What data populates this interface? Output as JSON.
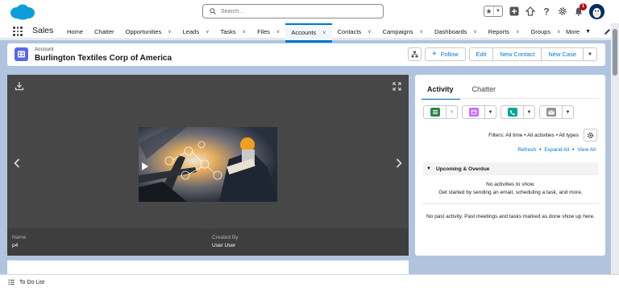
{
  "header": {
    "search_placeholder": "Search...",
    "notification_count": "1"
  },
  "nav": {
    "app_name": "Sales",
    "items": [
      {
        "label": "Home",
        "dropdown": false
      },
      {
        "label": "Chatter",
        "dropdown": false
      },
      {
        "label": "Opportunities",
        "dropdown": true
      },
      {
        "label": "Leads",
        "dropdown": true
      },
      {
        "label": "Tasks",
        "dropdown": true
      },
      {
        "label": "Files",
        "dropdown": true
      },
      {
        "label": "Accounts",
        "dropdown": true,
        "active": true
      },
      {
        "label": "Contacts",
        "dropdown": true
      },
      {
        "label": "Campaigns",
        "dropdown": true
      },
      {
        "label": "Dashboards",
        "dropdown": true
      },
      {
        "label": "Reports",
        "dropdown": true
      },
      {
        "label": "Groups",
        "dropdown": true
      }
    ],
    "more_label": "More"
  },
  "record": {
    "type_label": "Account",
    "name": "Burlington Textiles Corp of America",
    "follow_label": "Follow",
    "edit_label": "Edit",
    "new_contact_label": "New Contact",
    "new_case_label": "New Case"
  },
  "viewer": {
    "name_label": "Name",
    "name_value": "p4",
    "created_by_label": "Created By",
    "created_by_value": "User User"
  },
  "activity": {
    "tabs": [
      "Activity",
      "Chatter"
    ],
    "filters_text": "Filters: All time • All activities • All types",
    "refresh_link": "Refresh",
    "expand_all_link": "Expand All",
    "view_all_link": "View All",
    "upcoming_title": "Upcoming & Overdue",
    "no_activities_line1": "No activities to show.",
    "no_activities_line2": "Get started by sending an email, scheduling a task, and more.",
    "no_past_activity": "No past activity. Past meetings and tasks marked as done show up here."
  },
  "utility": {
    "todo_label": "To Do List"
  },
  "colors": {
    "brand": "#0176d3",
    "account_icon": "#5867e8",
    "log_call": "#2e844a",
    "event": "#cb65ff",
    "call": "#06a59a",
    "email": "#939393",
    "background": "#b0c4df"
  }
}
